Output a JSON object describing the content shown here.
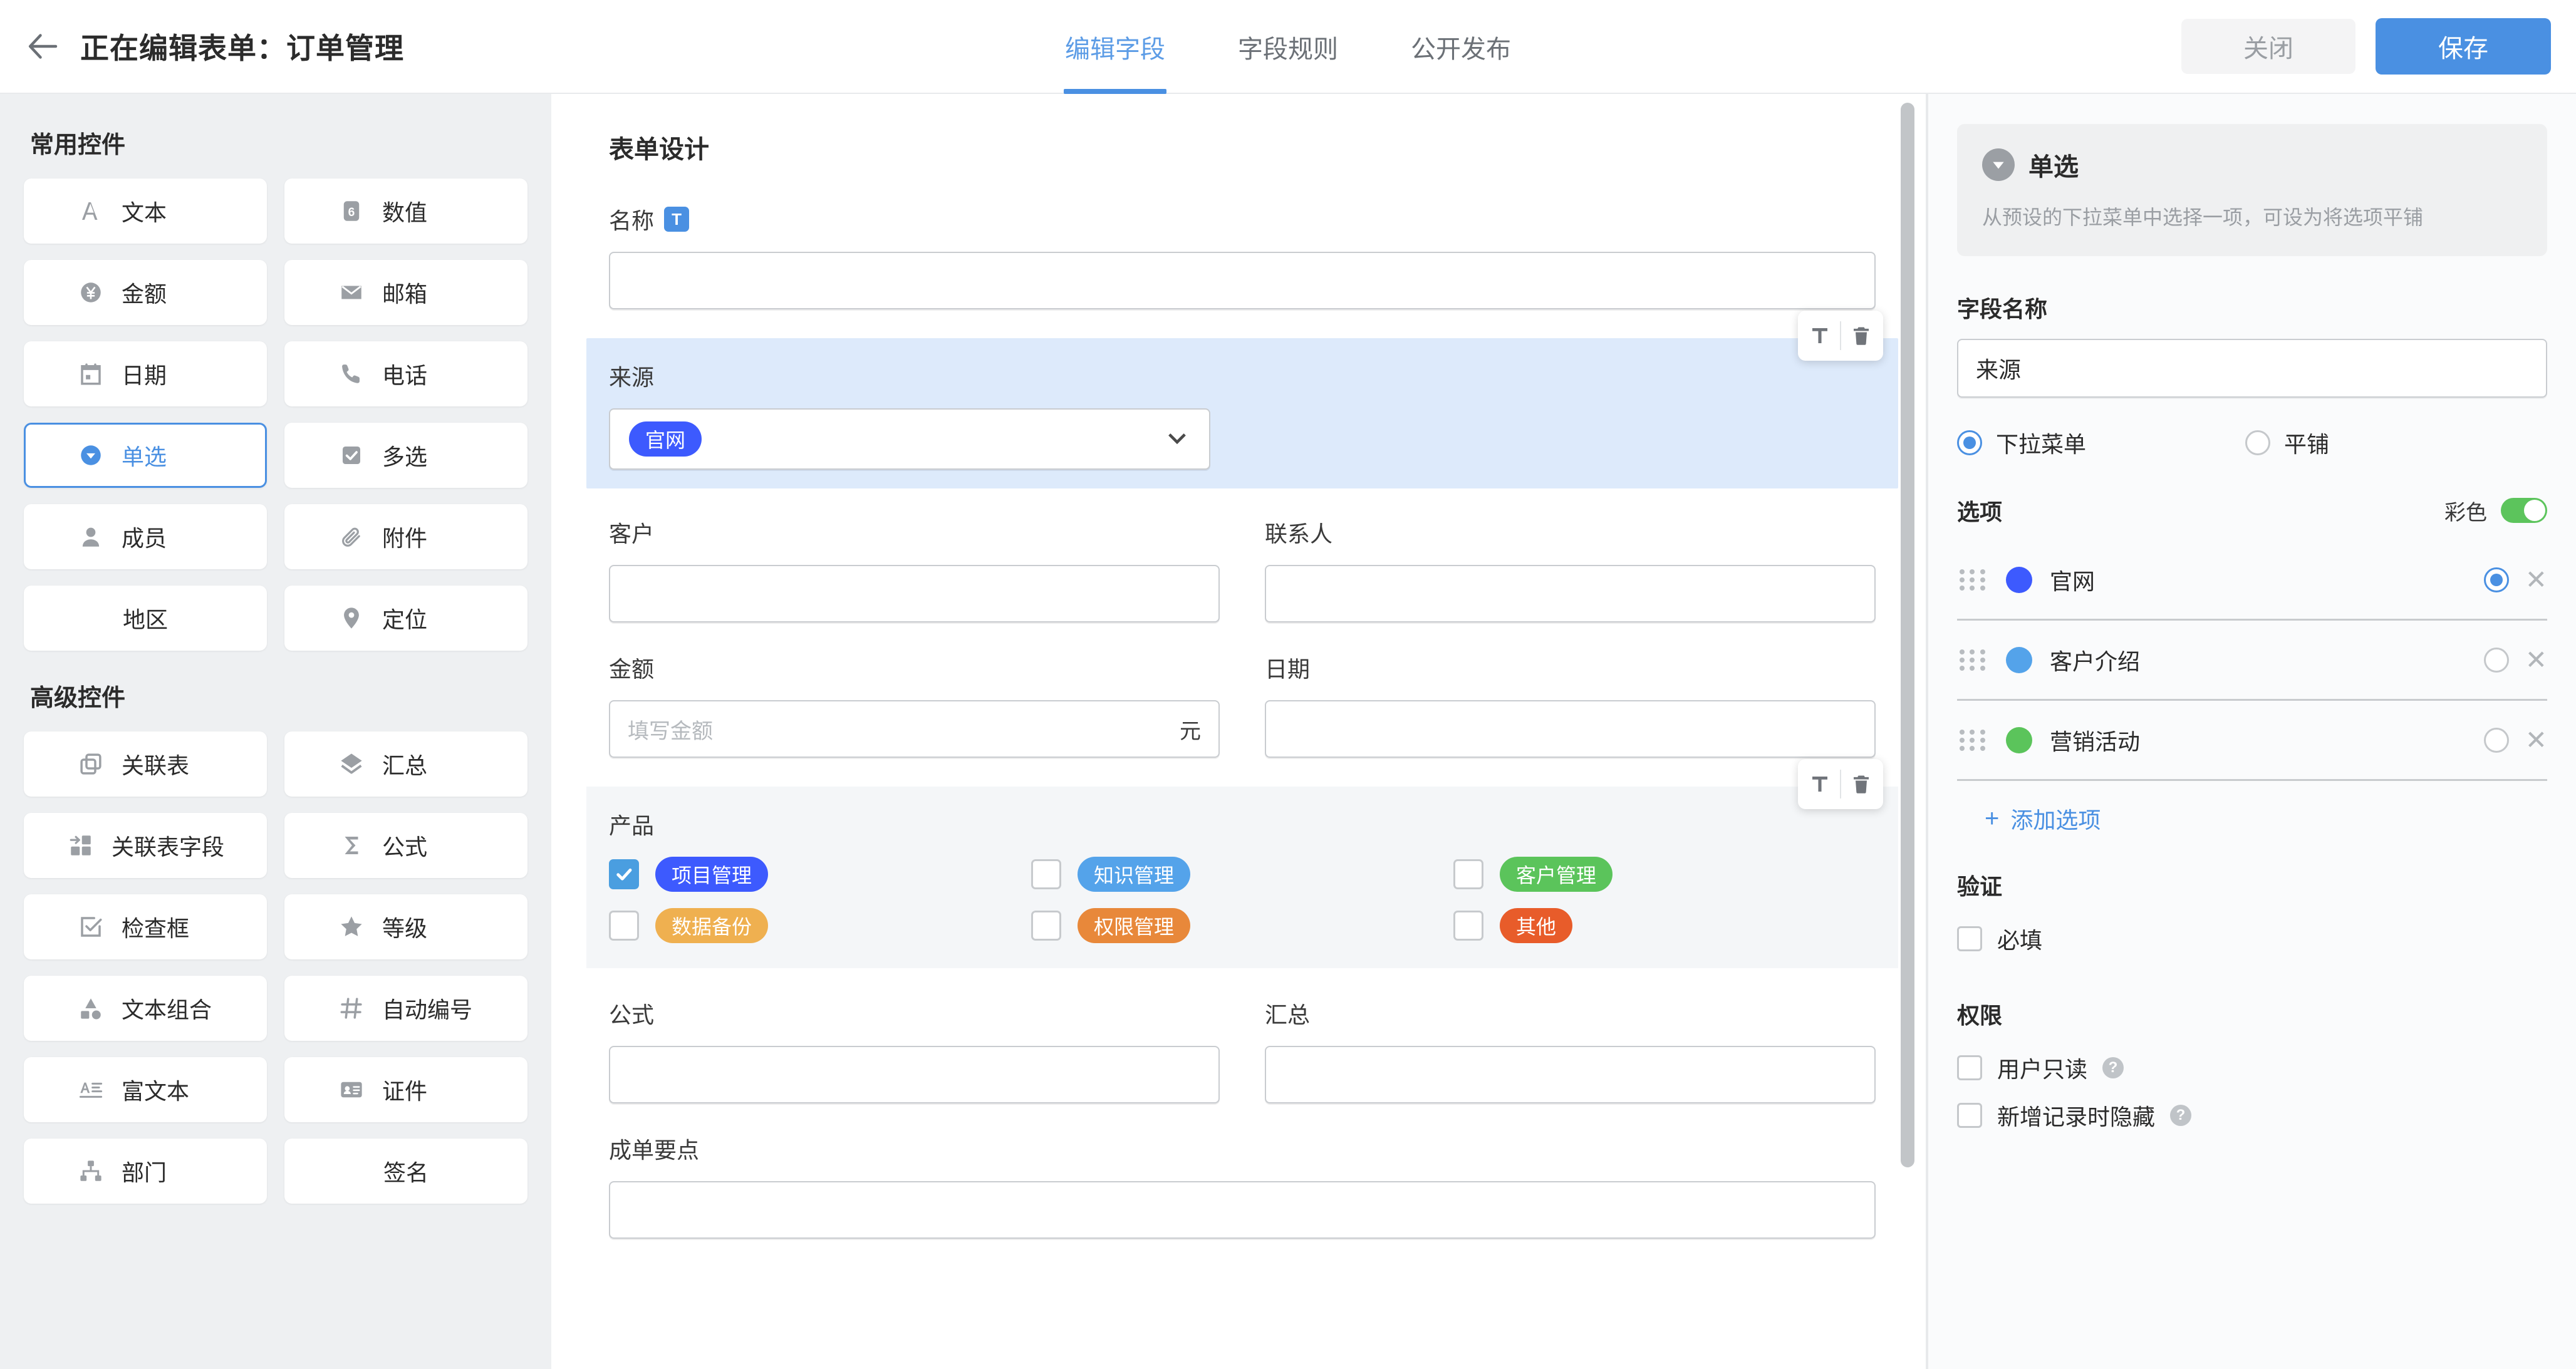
{
  "header": {
    "back_icon": "arrow-left-icon",
    "title": "正在编辑表单：订单管理",
    "tabs": [
      {
        "label": "编辑字段",
        "active": true
      },
      {
        "label": "字段规则",
        "active": false
      },
      {
        "label": "公开发布",
        "active": false
      }
    ],
    "close_label": "关闭",
    "save_label": "保存",
    "accent_color": "#4a90e2"
  },
  "palette": {
    "common_heading": "常用控件",
    "common_items": [
      {
        "label": "文本",
        "icon": "text-icon"
      },
      {
        "label": "数值",
        "icon": "number-icon"
      },
      {
        "label": "金额",
        "icon": "currency-icon"
      },
      {
        "label": "邮箱",
        "icon": "email-icon"
      },
      {
        "label": "日期",
        "icon": "calendar-icon"
      },
      {
        "label": "电话",
        "icon": "phone-icon"
      },
      {
        "label": "单选",
        "icon": "radio-icon",
        "active": true
      },
      {
        "label": "多选",
        "icon": "checkbox-icon"
      },
      {
        "label": "成员",
        "icon": "user-icon"
      },
      {
        "label": "附件",
        "icon": "attachment-icon"
      },
      {
        "label": "地区",
        "icon": "none"
      },
      {
        "label": "定位",
        "icon": "location-pin-icon"
      }
    ],
    "advanced_heading": "高级控件",
    "advanced_items": [
      {
        "label": "关联表",
        "icon": "linked-table-icon"
      },
      {
        "label": "汇总",
        "icon": "summary-icon"
      },
      {
        "label": "关联表字段",
        "icon": "linked-field-icon"
      },
      {
        "label": "公式",
        "icon": "sigma-icon"
      },
      {
        "label": "检查框",
        "icon": "check-square-icon"
      },
      {
        "label": "等级",
        "icon": "star-icon"
      },
      {
        "label": "文本组合",
        "icon": "shapes-icon"
      },
      {
        "label": "自动编号",
        "icon": "hash-icon"
      },
      {
        "label": "富文本",
        "icon": "rich-text-icon"
      },
      {
        "label": "证件",
        "icon": "id-card-icon"
      },
      {
        "label": "部门",
        "icon": "org-chart-icon"
      },
      {
        "label": "签名",
        "icon": "none"
      }
    ]
  },
  "canvas": {
    "title": "表单设计",
    "toolbar": {
      "edit_icon": "text-format-icon",
      "delete_icon": "trash-icon"
    },
    "fields": {
      "name": {
        "label": "名称",
        "badge": "T",
        "value": "",
        "badge_color": "#4a90e2"
      },
      "source": {
        "label": "来源",
        "selected": true,
        "tag": {
          "text": "官网",
          "color": "#3d5afe"
        },
        "chevron_icon": "chevron-down-icon"
      },
      "customer": {
        "label": "客户",
        "value": ""
      },
      "contact": {
        "label": "联系人",
        "value": ""
      },
      "amount": {
        "label": "金额",
        "placeholder": "填写金额",
        "unit": "元",
        "value": ""
      },
      "date": {
        "label": "日期",
        "value": ""
      },
      "product": {
        "label": "产品",
        "options": [
          {
            "text": "项目管理",
            "color": "#3d5afe",
            "checked": true
          },
          {
            "text": "知识管理",
            "color": "#54a3ea",
            "checked": false
          },
          {
            "text": "客户管理",
            "color": "#5bc45b",
            "checked": false
          },
          {
            "text": "数据备份",
            "color": "#efb050",
            "checked": false
          },
          {
            "text": "权限管理",
            "color": "#e8883a",
            "checked": false
          },
          {
            "text": "其他",
            "color": "#e85c2a",
            "checked": false
          }
        ]
      },
      "formula": {
        "label": "公式",
        "value": ""
      },
      "summary": {
        "label": "汇总",
        "value": ""
      },
      "key_points": {
        "label": "成单要点",
        "value": ""
      }
    }
  },
  "props": {
    "card": {
      "icon": "radio-select-icon",
      "title": "单选",
      "desc": "从预设的下拉菜单中选择一项，可设为将选项平铺"
    },
    "field_name_label": "字段名称",
    "field_name_value": "来源",
    "display_modes": [
      {
        "label": "下拉菜单",
        "selected": true
      },
      {
        "label": "平铺",
        "selected": false
      }
    ],
    "options_title": "选项",
    "color_switch_label": "彩色",
    "color_switch_on": true,
    "switch_on_color": "#5cc45c",
    "options": [
      {
        "name": "官网",
        "color": "#3d5afe",
        "is_default": true
      },
      {
        "name": "客户介绍",
        "color": "#54a3ea",
        "is_default": false
      },
      {
        "name": "营销活动",
        "color": "#5bc45b",
        "is_default": false
      }
    ],
    "add_option_label": "添加选项",
    "validation_title": "验证",
    "validation_items": [
      {
        "label": "必填",
        "checked": false
      }
    ],
    "permission_title": "权限",
    "permission_items": [
      {
        "label": "用户只读",
        "checked": false,
        "help": "?"
      },
      {
        "label": "新增记录时隐藏",
        "checked": false,
        "help": "?"
      }
    ]
  }
}
